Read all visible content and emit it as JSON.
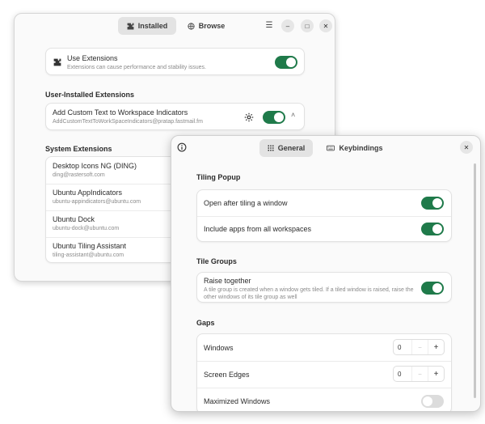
{
  "extensions_window": {
    "tabs": [
      {
        "label": "Installed",
        "icon": "puzzle-icon"
      },
      {
        "label": "Browse",
        "icon": "globe-icon"
      }
    ],
    "use_extensions": {
      "title": "Use Extensions",
      "subtitle": "Extensions can cause performance and stability issues.",
      "enabled": true
    },
    "user_section_title": "User-Installed Extensions",
    "user_extensions": [
      {
        "name": "Add Custom Text to Workspace Indicators",
        "id": "AddCustomTextToWorkSpaceIndicators@pratap.fastmail.fm",
        "enabled": true
      }
    ],
    "system_section_title": "System Extensions",
    "system_extensions": [
      {
        "name": "Desktop Icons NG (DING)",
        "id": "ding@rastersoft.com"
      },
      {
        "name": "Ubuntu AppIndicators",
        "id": "ubuntu-appindicators@ubuntu.com"
      },
      {
        "name": "Ubuntu Dock",
        "id": "ubuntu-dock@ubuntu.com"
      },
      {
        "name": "Ubuntu Tiling Assistant",
        "id": "tiling-assistant@ubuntu.com"
      }
    ]
  },
  "tiling_window": {
    "tabs": [
      {
        "label": "General",
        "icon": "grid-icon"
      },
      {
        "label": "Keybindings",
        "icon": "keyboard-icon"
      }
    ],
    "tiling_popup": {
      "title": "Tiling Popup",
      "rows": [
        {
          "label": "Open after tiling a window",
          "enabled": true
        },
        {
          "label": "Include apps from all workspaces",
          "enabled": true
        }
      ]
    },
    "tile_groups": {
      "title": "Tile Groups",
      "rows": [
        {
          "label": "Raise together",
          "subtitle": "A tile group is created when a window gets tiled. If a tiled window is raised, raise the other windows of its tile group as well",
          "enabled": true
        }
      ]
    },
    "gaps": {
      "title": "Gaps",
      "rows": [
        {
          "label": "Windows",
          "value": "0"
        },
        {
          "label": "Screen Edges",
          "value": "0"
        },
        {
          "label": "Maximized Windows",
          "enabled": false
        }
      ]
    }
  }
}
